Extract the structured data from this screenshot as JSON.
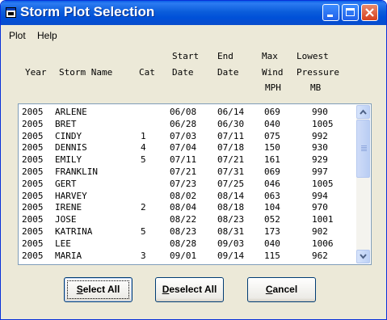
{
  "window": {
    "title": "Storm Plot Selection"
  },
  "menu": {
    "items": [
      "Plot",
      "Help"
    ]
  },
  "headers": {
    "line1": {
      "start": "Start",
      "end": "End",
      "max": "Max",
      "lowest": "Lowest"
    },
    "line2": {
      "year": "Year",
      "storm_name": "Storm Name",
      "cat": "Cat",
      "date_start": "Date",
      "date_end": "Date",
      "wind": "Wind",
      "pressure": "Pressure"
    },
    "line3": {
      "wind_unit": "MPH",
      "pressure_unit": "MB"
    }
  },
  "storms": [
    {
      "year": "2005",
      "name": "ARLENE",
      "cat": "",
      "start": "06/08",
      "end": "06/14",
      "wind": "069",
      "pressure": "990"
    },
    {
      "year": "2005",
      "name": "BRET",
      "cat": "",
      "start": "06/28",
      "end": "06/30",
      "wind": "040",
      "pressure": "1005"
    },
    {
      "year": "2005",
      "name": "CINDY",
      "cat": "1",
      "start": "07/03",
      "end": "07/11",
      "wind": "075",
      "pressure": "992"
    },
    {
      "year": "2005",
      "name": "DENNIS",
      "cat": "4",
      "start": "07/04",
      "end": "07/18",
      "wind": "150",
      "pressure": "930"
    },
    {
      "year": "2005",
      "name": "EMILY",
      "cat": "5",
      "start": "07/11",
      "end": "07/21",
      "wind": "161",
      "pressure": "929"
    },
    {
      "year": "2005",
      "name": "FRANKLIN",
      "cat": "",
      "start": "07/21",
      "end": "07/31",
      "wind": "069",
      "pressure": "997"
    },
    {
      "year": "2005",
      "name": "GERT",
      "cat": "",
      "start": "07/23",
      "end": "07/25",
      "wind": "046",
      "pressure": "1005"
    },
    {
      "year": "2005",
      "name": "HARVEY",
      "cat": "",
      "start": "08/02",
      "end": "08/14",
      "wind": "063",
      "pressure": "994"
    },
    {
      "year": "2005",
      "name": "IRENE",
      "cat": "2",
      "start": "08/04",
      "end": "08/18",
      "wind": "104",
      "pressure": "970"
    },
    {
      "year": "2005",
      "name": "JOSE",
      "cat": "",
      "start": "08/22",
      "end": "08/23",
      "wind": "052",
      "pressure": "1001"
    },
    {
      "year": "2005",
      "name": "KATRINA",
      "cat": "5",
      "start": "08/23",
      "end": "08/31",
      "wind": "173",
      "pressure": "902"
    },
    {
      "year": "2005",
      "name": "LEE",
      "cat": "",
      "start": "08/28",
      "end": "09/03",
      "wind": "040",
      "pressure": "1006"
    },
    {
      "year": "2005",
      "name": "MARIA",
      "cat": "3",
      "start": "09/01",
      "end": "09/14",
      "wind": "115",
      "pressure": "962"
    }
  ],
  "buttons": {
    "select_all": {
      "mnemonic": "S",
      "rest": "elect All"
    },
    "deselect_all": {
      "mnemonic": "D",
      "rest": "eselect All"
    },
    "cancel": {
      "mnemonic": "C",
      "rest": "ancel"
    }
  },
  "colors": {
    "titlebar": "#0054e3",
    "face": "#ece9d8",
    "close_button": "#d6401e"
  }
}
